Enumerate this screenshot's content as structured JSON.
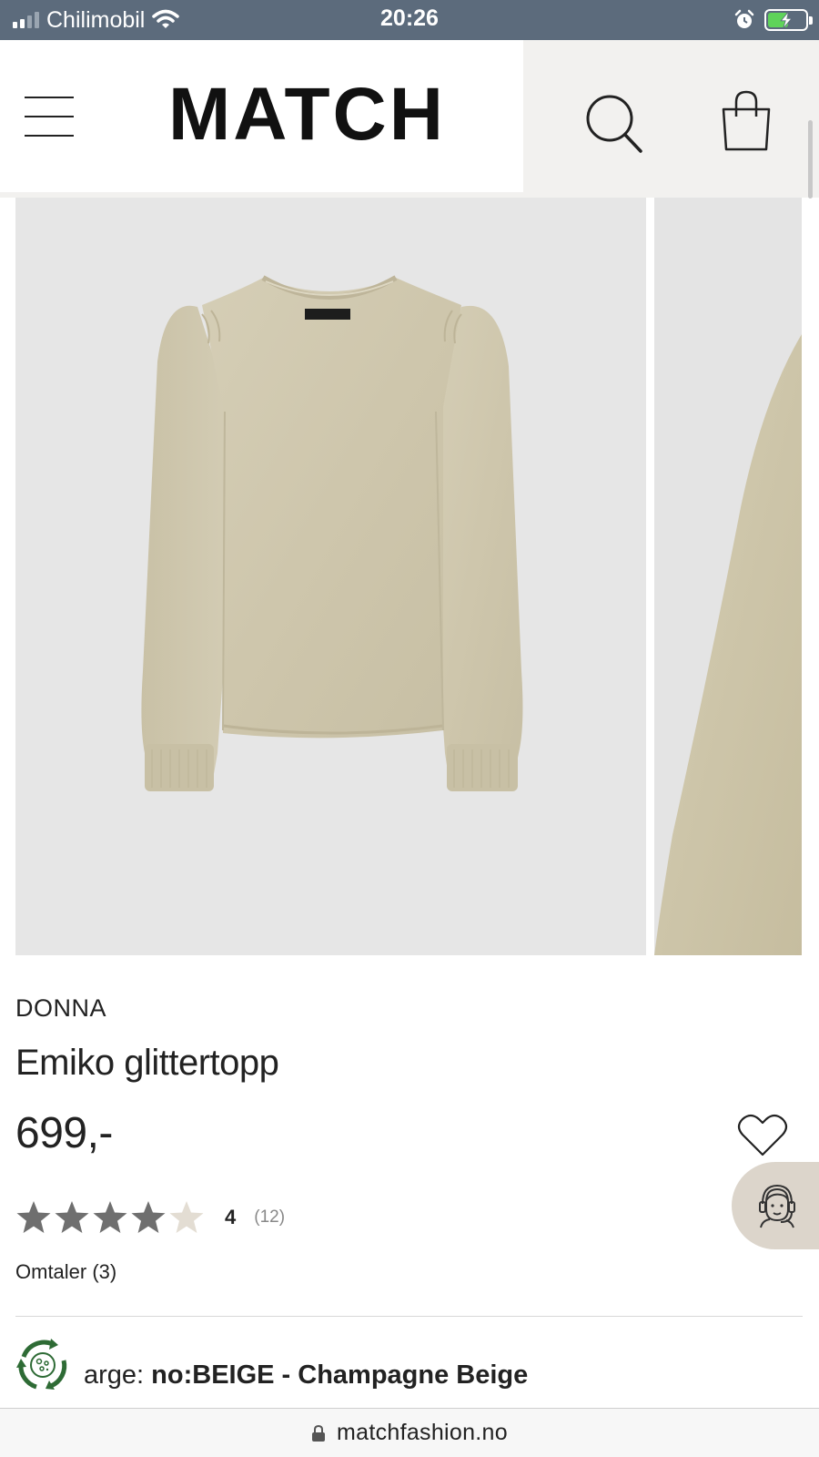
{
  "status_bar": {
    "carrier": "Chilimobil",
    "time": "20:26",
    "battery_charging": true
  },
  "header": {
    "logo": "MATCH",
    "icons": [
      "menu-icon",
      "search-icon",
      "shopping-bag-icon"
    ]
  },
  "product": {
    "brand": "DONNA",
    "name": "Emiko glittertopp",
    "price": "699,-",
    "rating": {
      "value": "4",
      "count": "(12)",
      "stars_filled": 4,
      "stars_total": 5
    },
    "reviews_link": "Omtaler (3)",
    "color": {
      "label": "arge:",
      "value": "no:BEIGE - Champagne Beige"
    }
  },
  "browser": {
    "url": "matchfashion.no"
  },
  "colors": {
    "status_bar": "#5c6b7c",
    "header_bg": "#f2f1ef",
    "product_fabric": "#d2cbb2",
    "star_filled": "#6f6f6f",
    "star_empty": "#e3ddd3",
    "chat_bg": "#dcd5cb",
    "eco_green": "#2e6b35"
  }
}
